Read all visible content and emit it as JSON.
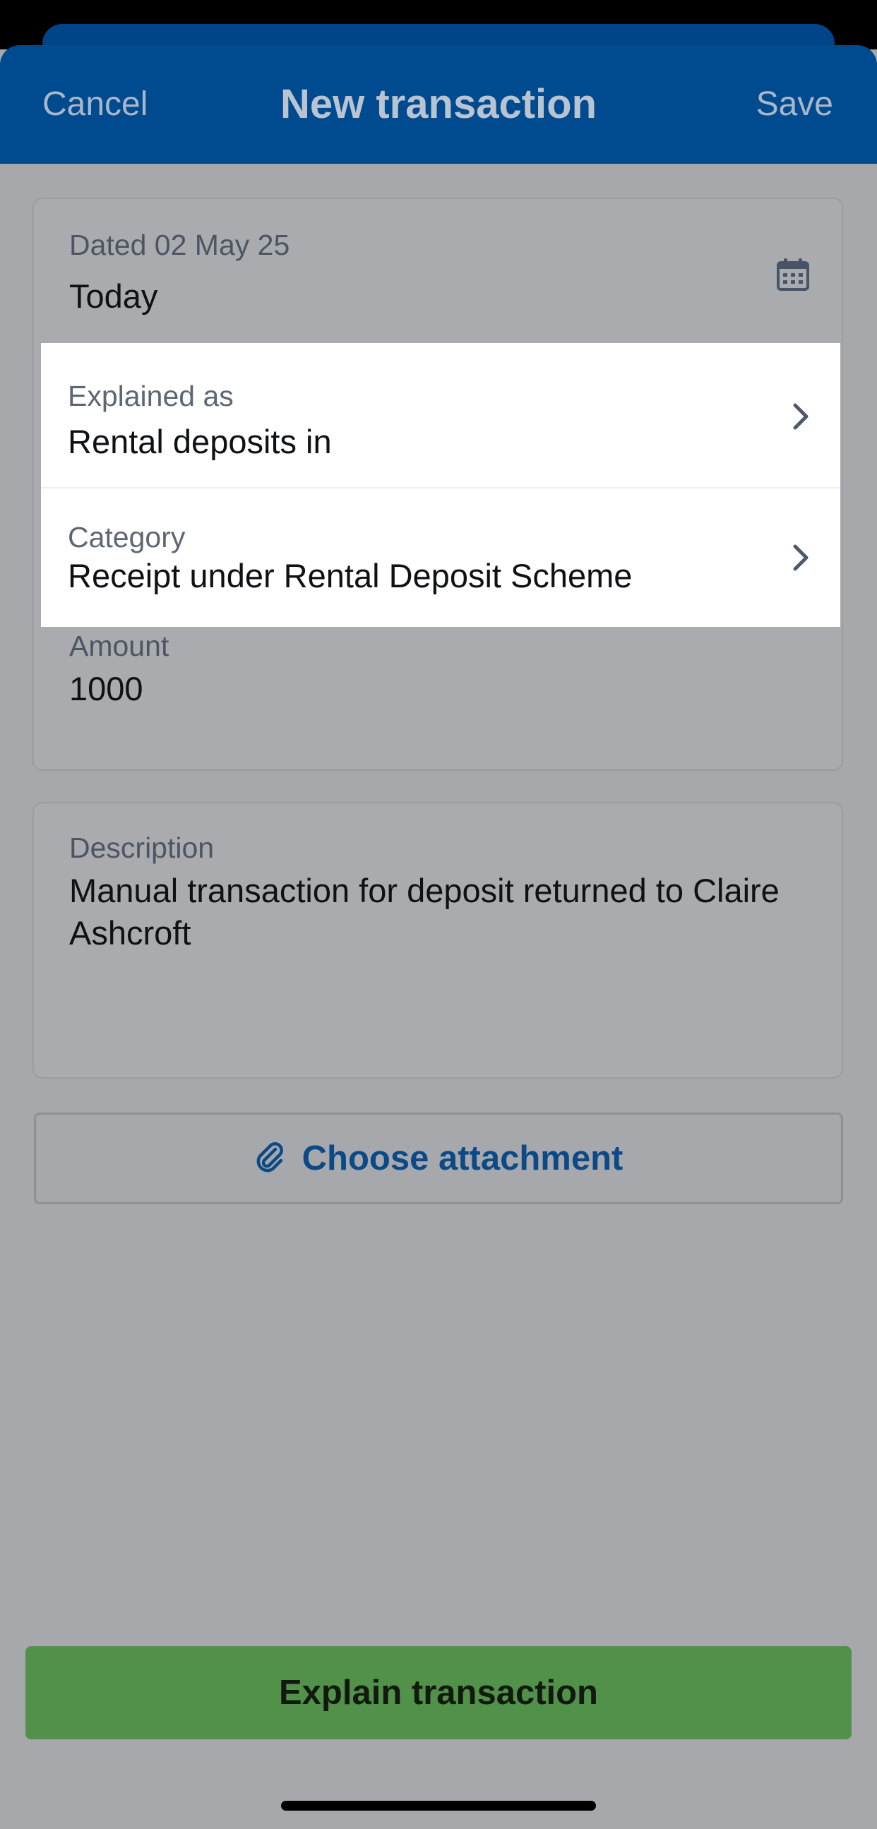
{
  "header": {
    "cancel_label": "Cancel",
    "title": "New transaction",
    "save_label": "Save"
  },
  "form": {
    "date": {
      "label": "Dated 02 May 25",
      "value": "Today",
      "icon": "calendar-icon"
    },
    "explained_as": {
      "label": "Explained as",
      "value": "Rental deposits in",
      "icon": "chevron-right-icon"
    },
    "category": {
      "label": "Category",
      "value": "Receipt under Rental Deposit Scheme",
      "icon": "chevron-right-icon"
    },
    "amount": {
      "label": "Amount",
      "value": "1000"
    },
    "description": {
      "label": "Description",
      "value": "Manual transaction for deposit returned to Claire Ashcroft"
    }
  },
  "attachment": {
    "label": "Choose attachment",
    "icon": "paperclip-icon"
  },
  "primary_action": {
    "label": "Explain transaction"
  },
  "colors": {
    "header_bg": "#004a8f",
    "overlay_bg": "#a7a8ac",
    "accent_blue": "#0b4a86",
    "primary_green": "#52914a"
  }
}
